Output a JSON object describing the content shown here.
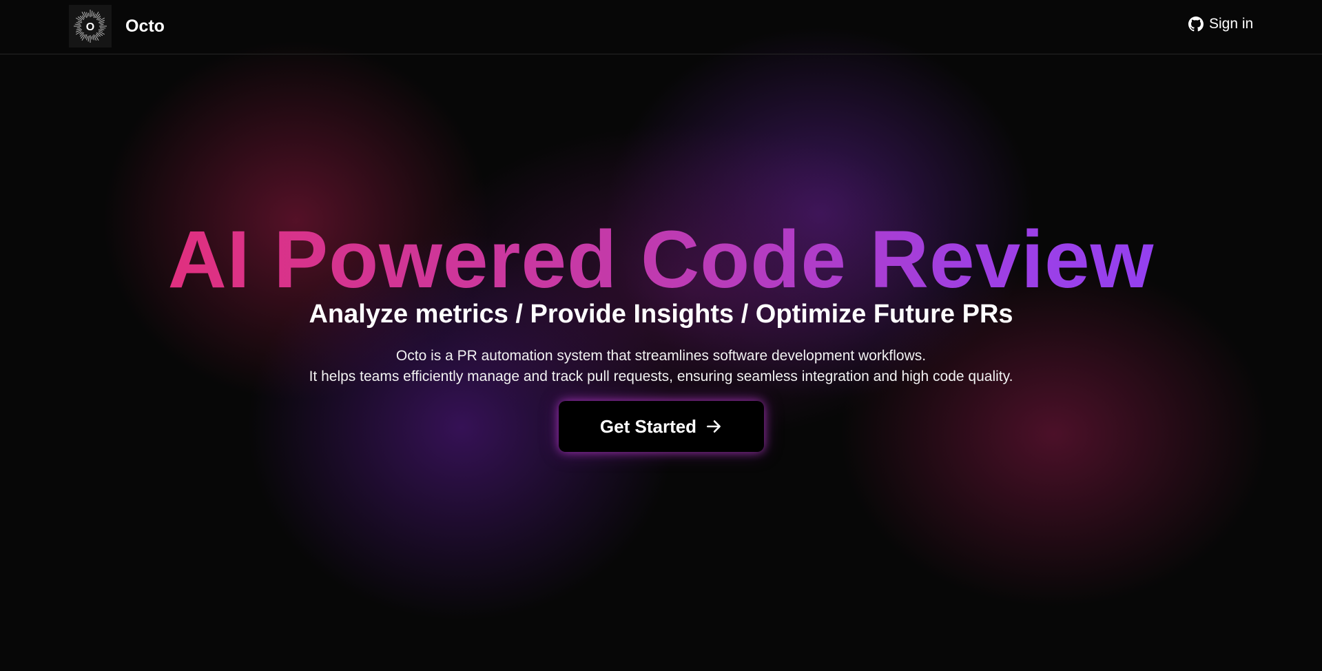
{
  "nav": {
    "brand_name": "Octo",
    "logo_letter": "O",
    "logo_icon": "sunburst-logo-icon",
    "signin_label": "Sign in",
    "signin_icon": "github-icon"
  },
  "hero": {
    "headline": "AI Powered Code Review",
    "subheadline": "Analyze metrics / Provide Insights / Optimize Future PRs",
    "description_line1": "Octo is a PR automation system that streamlines software development workflows.",
    "description_line2": "It helps teams efficiently manage and track pull requests, ensuring seamless integration and high code quality.",
    "cta_label": "Get Started",
    "cta_icon": "arrow-right-icon"
  },
  "colors": {
    "background": "#070707",
    "headline_gradient_start": "#e0307f",
    "headline_gradient_end": "#9440f0",
    "glow_red": "#6e1432",
    "glow_purple": "#46196e",
    "button_bg": "#000000",
    "button_glow": "#be3cd2"
  }
}
